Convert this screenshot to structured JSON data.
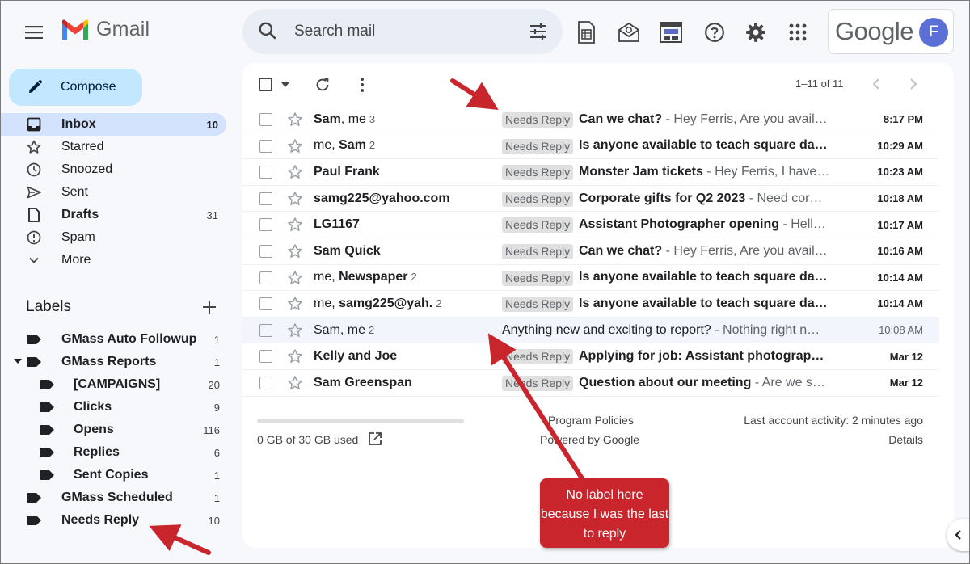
{
  "app": {
    "name": "Gmail"
  },
  "search": {
    "placeholder": "Search mail"
  },
  "account": {
    "brand": "Google",
    "avatar_letter": "F",
    "avatar_color": "#5b6fd6"
  },
  "compose": {
    "label": "Compose"
  },
  "nav": [
    {
      "label": "Inbox",
      "count": "10",
      "icon": "inbox-icon",
      "active": true,
      "bold": true
    },
    {
      "label": "Starred",
      "count": "",
      "icon": "star-icon"
    },
    {
      "label": "Snoozed",
      "count": "",
      "icon": "clock-icon"
    },
    {
      "label": "Sent",
      "count": "",
      "icon": "send-icon"
    },
    {
      "label": "Drafts",
      "count": "31",
      "icon": "draft-icon",
      "bold": true
    },
    {
      "label": "Spam",
      "count": "",
      "icon": "spam-icon"
    },
    {
      "label": "More",
      "count": "",
      "icon": "chevron-down-icon"
    }
  ],
  "labels": {
    "heading": "Labels",
    "items": [
      {
        "label": "GMass Auto Followup",
        "count": "1",
        "indent": 0
      },
      {
        "label": "GMass Reports",
        "count": "1",
        "indent": 0,
        "expanded": true
      },
      {
        "label": "[CAMPAIGNS]",
        "count": "20",
        "indent": 1
      },
      {
        "label": "Clicks",
        "count": "9",
        "indent": 1
      },
      {
        "label": "Opens",
        "count": "116",
        "indent": 1
      },
      {
        "label": "Replies",
        "count": "6",
        "indent": 1
      },
      {
        "label": "Sent Copies",
        "count": "1",
        "indent": 1
      },
      {
        "label": "GMass Scheduled",
        "count": "1",
        "indent": 0
      },
      {
        "label": "Needs Reply",
        "count": "10",
        "indent": 0
      }
    ]
  },
  "toolbar": {
    "pager": "1–11 of 11"
  },
  "emails": [
    {
      "sender_parts": [
        [
          "Sam",
          true
        ],
        [
          ", me",
          false
        ]
      ],
      "thread": "3",
      "label": "Needs Reply",
      "subject": "Can we chat?",
      "snippet": " - Hey Ferris, Are you avail…",
      "time": "8:17 PM",
      "unread": true
    },
    {
      "sender_parts": [
        [
          "me, ",
          false
        ],
        [
          "Sam",
          true
        ]
      ],
      "thread": "2",
      "label": "Needs Reply",
      "subject": "Is anyone available to teach square da…",
      "snippet": "",
      "time": "10:29 AM",
      "unread": true
    },
    {
      "sender_parts": [
        [
          "Paul Frank",
          true
        ]
      ],
      "thread": "",
      "label": "Needs Reply",
      "subject": "Monster Jam tickets",
      "snippet": " - Hey Ferris, I have…",
      "time": "10:23 AM",
      "unread": true
    },
    {
      "sender_parts": [
        [
          "samg225@yahoo.com",
          true
        ]
      ],
      "thread": "",
      "label": "Needs Reply",
      "subject": "Corporate gifts for Q2 2023",
      "snippet": " - Need cor…",
      "time": "10:18 AM",
      "unread": true
    },
    {
      "sender_parts": [
        [
          "LG1167",
          true
        ]
      ],
      "thread": "",
      "label": "Needs Reply",
      "subject": "Assistant Photographer opening",
      "snippet": " - Hell…",
      "time": "10:17 AM",
      "unread": true
    },
    {
      "sender_parts": [
        [
          "Sam Quick",
          true
        ]
      ],
      "thread": "",
      "label": "Needs Reply",
      "subject": "Can we chat?",
      "snippet": " - Hey Ferris, Are you avail…",
      "time": "10:16 AM",
      "unread": true
    },
    {
      "sender_parts": [
        [
          "me, ",
          false
        ],
        [
          "Newspaper",
          true
        ]
      ],
      "thread": "2",
      "label": "Needs Reply",
      "subject": "Is anyone available to teach square da…",
      "snippet": "",
      "time": "10:14 AM",
      "unread": true
    },
    {
      "sender_parts": [
        [
          "me, ",
          false
        ],
        [
          "samg225@yah.",
          true
        ]
      ],
      "thread": "2",
      "label": "Needs Reply",
      "subject": "Is anyone available to teach square da…",
      "snippet": "",
      "time": "10:14 AM",
      "unread": true
    },
    {
      "sender_parts": [
        [
          "Sam, me",
          false
        ]
      ],
      "thread": "2",
      "label": "",
      "subject": "Anything new and exciting to report?",
      "snippet": " - Nothing right n…",
      "time": "10:08 AM",
      "unread": false
    },
    {
      "sender_parts": [
        [
          "Kelly and Joe",
          true
        ]
      ],
      "thread": "",
      "label": "Needs Reply",
      "subject": "Applying for job: Assistant photograp…",
      "snippet": "",
      "time": "Mar 12",
      "unread": true
    },
    {
      "sender_parts": [
        [
          "Sam Greenspan",
          true
        ]
      ],
      "thread": "",
      "label": "Needs Reply",
      "subject": "Question about our meeting",
      "snippet": " - Are we s…",
      "time": "Mar 12",
      "unread": true
    }
  ],
  "footer": {
    "storage": "0 GB of 30 GB used",
    "storage_used_fraction": 0,
    "policies": "Program Policies",
    "powered": "Powered by Google",
    "activity": "Last account activity: 2 minutes ago",
    "details": "Details"
  },
  "annotation": {
    "callout": "No label here because I was the last to reply",
    "color": "#c9252c"
  }
}
